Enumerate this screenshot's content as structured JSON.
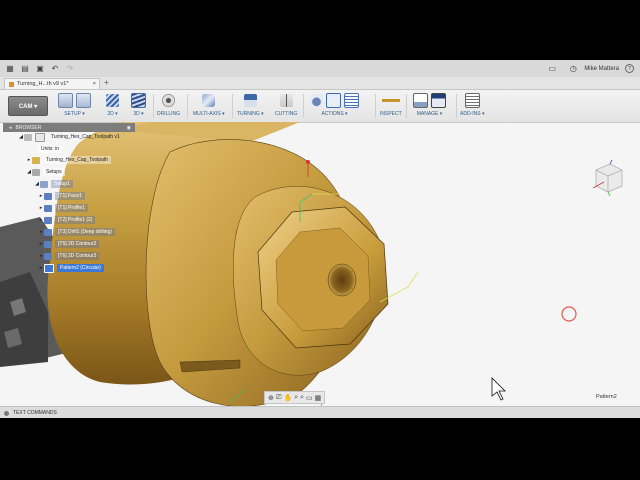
{
  "topbar": {
    "user": "Mike Mattera",
    "help": "?"
  },
  "tab": {
    "title": "Turning_H...th v9 v1*",
    "close": "×",
    "add": "+"
  },
  "toolbar": {
    "workspace": "CAM ▾",
    "groups": [
      {
        "label": "SETUP ▾"
      },
      {
        "label": "2D ▾"
      },
      {
        "label": "3D ▾"
      },
      {
        "label": "DRILLING"
      },
      {
        "label": "MULTI-AXIS ▾"
      },
      {
        "label": "TURNING ▾"
      },
      {
        "label": "CUTTING"
      },
      {
        "label": "ACTIONS ▾"
      },
      {
        "label": "INSPECT"
      },
      {
        "label": "MANAGE ▾"
      },
      {
        "label": "ADD-INS ▾"
      }
    ]
  },
  "browser": {
    "title": "BROWSER",
    "root": "Turning_Hex_Cap_Toolpath v1",
    "units": "Units: in",
    "component": "Turning_Hex_Cap_Toolpath",
    "setups": "Setups",
    "setup1": "Setup1",
    "ops": [
      "[T1] Face1",
      "[T1] Profile1",
      "[T2] Profile1 (2)",
      "[T3] Drill1 (Deep drilling)",
      "[T5] 2D Contour2",
      "[T6] 2D Contour3"
    ],
    "pattern": "Pattern2 (Circular)"
  },
  "status": {
    "text_commands": "TEXT COMMANDS",
    "selection": "Pattern2"
  },
  "colors": {
    "brass": "#c39a3c",
    "brass_dark": "#8a6520",
    "selection_blue": "#3c78d8",
    "accent_red": "#e05a4e"
  }
}
